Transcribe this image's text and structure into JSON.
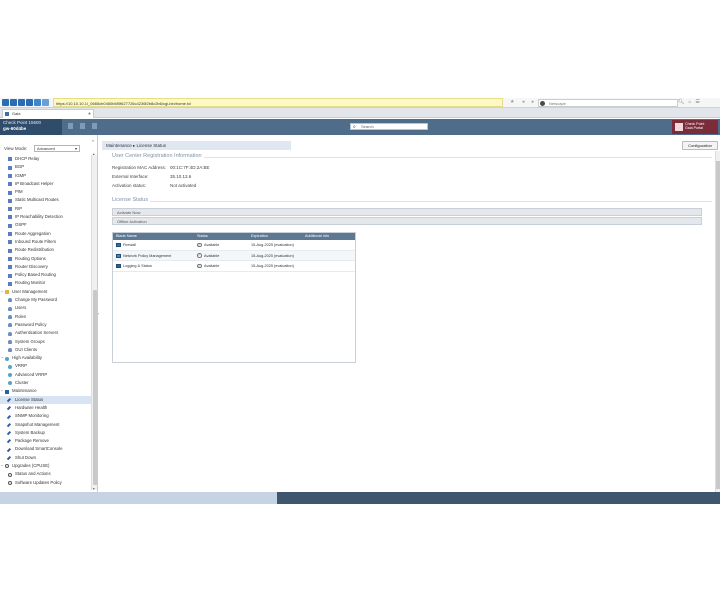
{
  "browser": {
    "url": "https://10.10.10.1/_0665cb0460b6f0f627726c4236f2b8c2b6/cgi-bin/home.tcl",
    "search_placeholder": "Netscape",
    "tab_title": "Gaia"
  },
  "header": {
    "device_line1": "Check Point 15600",
    "device_line2": "gw-60d4be",
    "search_placeholder": "Search",
    "support_line1": "Check Point",
    "support_line2": "Gaia Portal"
  },
  "sidebar": {
    "view_mode_label": "View Mode:",
    "view_mode_value": "Advanced",
    "items": [
      {
        "label": "DHCP Relay",
        "icon": "route-icon",
        "indent": 1
      },
      {
        "label": "BGP",
        "icon": "route-icon",
        "indent": 1
      },
      {
        "label": "IGMP",
        "icon": "route-icon",
        "indent": 1
      },
      {
        "label": "IP Broadcast Helper",
        "icon": "route-icon",
        "indent": 1
      },
      {
        "label": "PIM",
        "icon": "route-icon",
        "indent": 1
      },
      {
        "label": "Static Multicast Routes",
        "icon": "route-icon",
        "indent": 1
      },
      {
        "label": "RIP",
        "icon": "route-icon",
        "indent": 1
      },
      {
        "label": "IP Reachability Detection",
        "icon": "route-icon",
        "indent": 1
      },
      {
        "label": "OSPF",
        "icon": "route-icon",
        "indent": 1
      },
      {
        "label": "Route Aggregation",
        "icon": "route-icon",
        "indent": 1
      },
      {
        "label": "Inbound Route Filters",
        "icon": "route-icon",
        "indent": 1
      },
      {
        "label": "Route Redistribution",
        "icon": "route-icon",
        "indent": 1
      },
      {
        "label": "Routing Options",
        "icon": "route-icon",
        "indent": 1
      },
      {
        "label": "Router Discovery",
        "icon": "route-icon",
        "indent": 1
      },
      {
        "label": "Policy Based Routing",
        "icon": "route-icon",
        "indent": 1
      },
      {
        "label": "Routing Monitor",
        "icon": "route-icon",
        "indent": 1
      },
      {
        "label": "User Management",
        "icon": "folder-icon",
        "indent": 0,
        "expander": "−"
      },
      {
        "label": "Change My Password",
        "icon": "user-icon",
        "indent": 1
      },
      {
        "label": "Users",
        "icon": "user-icon",
        "indent": 1
      },
      {
        "label": "Roles",
        "icon": "user-icon",
        "indent": 1
      },
      {
        "label": "Password Policy",
        "icon": "user-icon",
        "indent": 1
      },
      {
        "label": "Authentication Servers",
        "icon": "user-icon",
        "indent": 1
      },
      {
        "label": "System Groups",
        "icon": "user-icon",
        "indent": 1
      },
      {
        "label": "GUI Clients",
        "icon": "user-icon",
        "indent": 1
      },
      {
        "label": "High Availability",
        "icon": "ha-icon",
        "indent": 0,
        "expander": "−"
      },
      {
        "label": "VRRP",
        "icon": "ha-icon",
        "indent": 1
      },
      {
        "label": "Advanced VRRP",
        "icon": "ha-icon",
        "indent": 1
      },
      {
        "label": "Cluster",
        "icon": "ha-icon",
        "indent": 1
      },
      {
        "label": "Maintenance",
        "icon": "cog-icon",
        "indent": 0,
        "expander": "−"
      },
      {
        "label": "License Status",
        "icon": "wrench-icon",
        "indent": 1,
        "selected": true
      },
      {
        "label": "Hardware Health",
        "icon": "wrench-icon",
        "indent": 1
      },
      {
        "label": "SNMP Monitoring",
        "icon": "wrench-icon",
        "indent": 1
      },
      {
        "label": "Snapshot Management",
        "icon": "wrench-icon",
        "indent": 1
      },
      {
        "label": "System Backup",
        "icon": "wrench-icon",
        "indent": 1
      },
      {
        "label": "Package Remove",
        "icon": "wrench-icon",
        "indent": 1
      },
      {
        "label": "Download SmartConsole",
        "icon": "wrench-icon",
        "indent": 1
      },
      {
        "label": "Shut Down",
        "icon": "wrench-icon",
        "indent": 1
      },
      {
        "label": "Upgrades (CPUSE)",
        "icon": "circle-icon",
        "indent": 0,
        "expander": "−"
      },
      {
        "label": "Status and Actions",
        "icon": "circle-icon",
        "indent": 1
      },
      {
        "label": "Software Updates Policy",
        "icon": "circle-icon",
        "indent": 1
      }
    ]
  },
  "main": {
    "breadcrumb": "Maintenance  ▸  License Status",
    "configuration_button": "Configuration",
    "user_center_title": "User Center Registration Information",
    "registration": [
      {
        "label": "Registration MAC Address:",
        "value": "00:1C:7F:4D:2A:BE"
      },
      {
        "label": "External Interface:",
        "value": "35.10.13.6"
      },
      {
        "label": "Activation status:",
        "value": "Not activated"
      }
    ],
    "license_status_title": "License Status",
    "activate_now": "Activate Now",
    "offline_activation": "Offline Activation",
    "table": {
      "columns": [
        "Blade Name",
        "Status",
        "Expiration",
        "Additional Info"
      ],
      "rows": [
        {
          "name": "Firewall",
          "status": "Available",
          "expiration": "15-Aug-2025 (evaluation)"
        },
        {
          "name": "Network Policy Management",
          "status": "Available",
          "expiration": "15-Aug-2025 (evaluation)"
        },
        {
          "name": "Logging & Status",
          "status": "Available",
          "expiration": "15-Aug-2025 (evaluation)"
        }
      ]
    }
  }
}
